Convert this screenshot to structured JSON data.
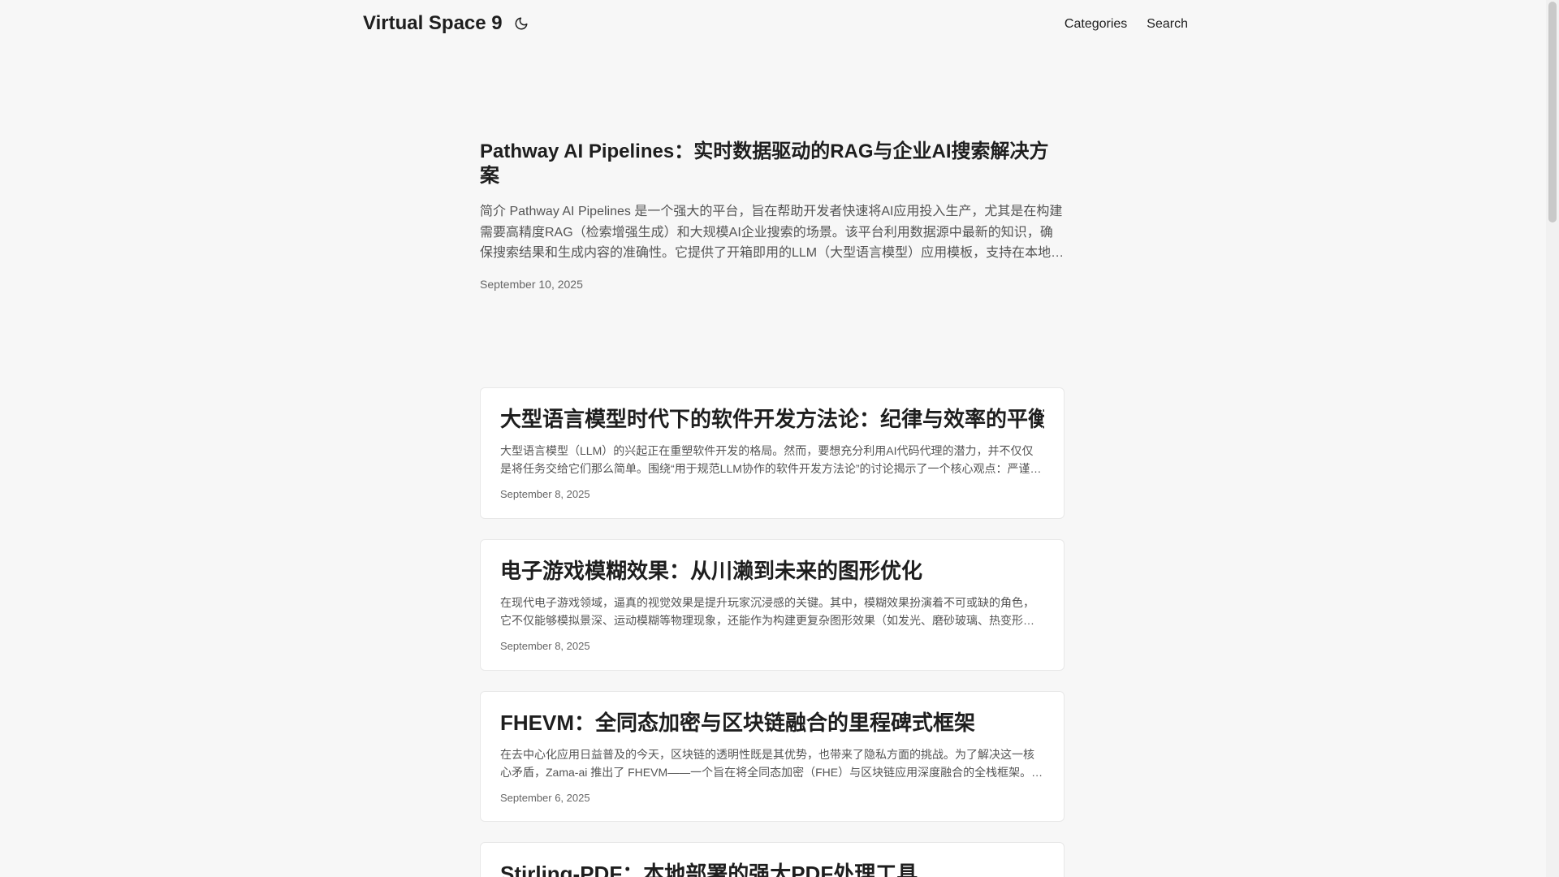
{
  "site": {
    "title": "Virtual Space 9",
    "theme_icon": "moon-icon"
  },
  "nav": {
    "items": [
      {
        "label": "Categories"
      },
      {
        "label": "Search"
      }
    ]
  },
  "featured": {
    "title": "Pathway AI Pipelines：实时数据驱动的RAG与企业AI搜索解决方案",
    "summary": "简介 Pathway AI Pipelines 是一个强大的平台，旨在帮助开发者快速将AI应用投入生产，尤其是在构建需要高精度RAG（检索增强生成）和大规模AI企业搜索的场景。该平台利用数据源中最新的知识，确保搜索结果和生成内容的准确性。它提供了开箱即用的LLM（大型语言模型）应用模板，支持在本地…",
    "date": "September 10, 2025"
  },
  "posts": [
    {
      "title": "大型语言模型时代下的软件开发方法论：纪律与效率的平衡",
      "summary": "大型语言模型（LLM）的兴起正在重塑软件开发的格局。然而，要想充分利用AI代码代理的潜力，并不仅仅是将任务交给它们那么简单。围绕“用于规范LLM协作的软件开发方法论”的讨论揭示了一个核心观点：严谨…",
      "date": "September 8, 2025"
    },
    {
      "title": "电子游戏模糊效果：从川濑到未来的图形优化",
      "summary": "在现代电子游戏领域，逼真的视觉效果是提升玩家沉浸感的关键。其中，模糊效果扮演着不可或缺的角色，它不仅能够模拟景深、运动模糊等物理现象，还能作为构建更复杂图形效果（如发光、磨砂玻璃、热变形…",
      "date": "September 8, 2025"
    },
    {
      "title": "FHEVM：全同态加密与区块链融合的里程碑式框架",
      "summary": "在去中心化应用日益普及的今天，区块链的透明性既是其优势，也带来了隐私方面的挑战。为了解决这一核心矛盾，Zama-ai 推出了 FHEVM——一个旨在将全同态加密（FHE）与区块链应用深度融合的全栈框架。…",
      "date": "September 6, 2025"
    },
    {
      "title": "Stirling-PDF：本地部署的强大PDF处理工具",
      "summary": "",
      "date": ""
    }
  ]
}
